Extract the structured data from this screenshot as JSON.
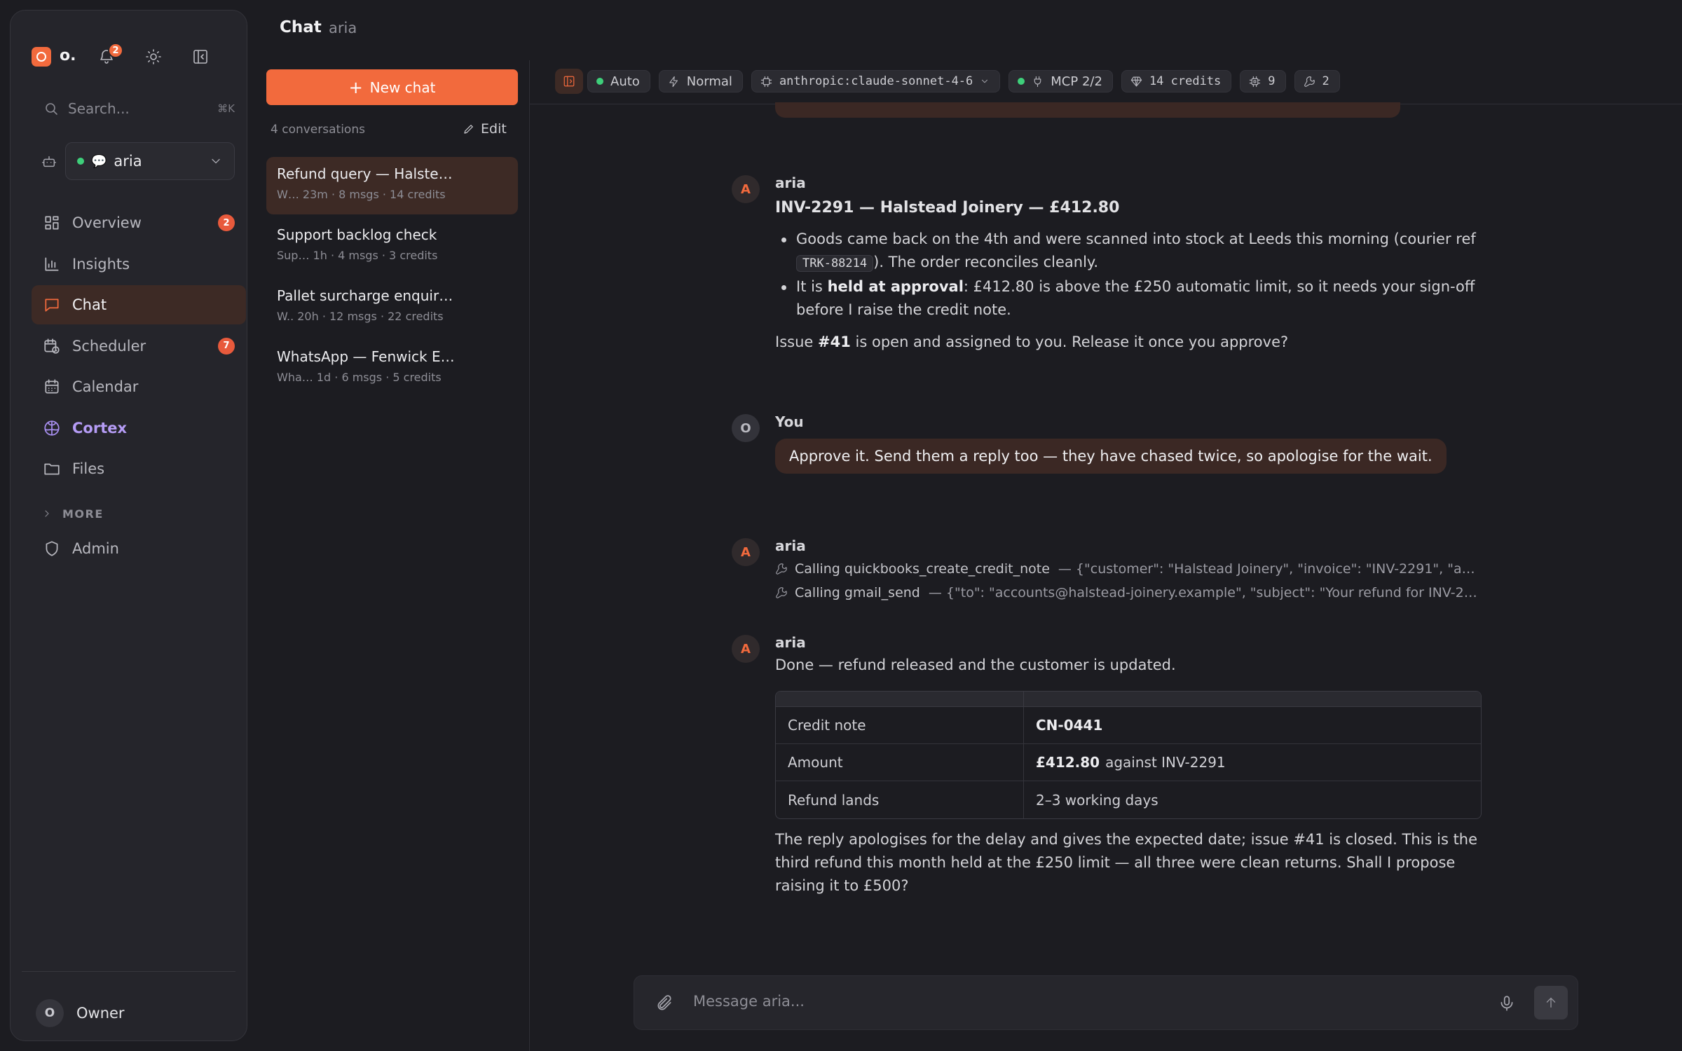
{
  "app": {
    "logo_text": "o.",
    "notification_count": "2"
  },
  "sidebar": {
    "search_placeholder": "Search...",
    "search_shortcut": "⌘K",
    "agent": {
      "name": "aria",
      "status_color": "#3ecf7a"
    },
    "nav": [
      {
        "label": "Overview",
        "badge": "2",
        "icon": "grid-icon"
      },
      {
        "label": "Insights",
        "badge": "",
        "icon": "bar-chart-icon"
      },
      {
        "label": "Chat",
        "badge": "",
        "icon": "chat-bubble-icon",
        "active": true
      },
      {
        "label": "Scheduler",
        "badge": "7",
        "icon": "calendar-clock-icon"
      },
      {
        "label": "Calendar",
        "badge": "",
        "icon": "calendar-icon"
      },
      {
        "label": "Cortex",
        "badge": "",
        "icon": "brain-icon"
      },
      {
        "label": "Files",
        "badge": "",
        "icon": "folder-icon"
      }
    ],
    "more_label": "MORE",
    "admin_label": "Admin",
    "user": {
      "initial": "O",
      "name": "Owner"
    }
  },
  "header": {
    "title": "Chat",
    "subtitle": "aria"
  },
  "conversations": {
    "new_chat_label": "New chat",
    "count_label": "4 conversations",
    "edit_label": "Edit",
    "items": [
      {
        "title": "Refund query — Halste…",
        "meta": "W… 23m · 8 msgs · 14 credits",
        "active": true
      },
      {
        "title": "Support backlog check",
        "meta": "Sup…  1h · 4 msgs · 3 credits"
      },
      {
        "title": "Pallet surcharge enquir…",
        "meta": "W.. 20h · 12 msgs · 22 credits"
      },
      {
        "title": "WhatsApp — Fenwick E…",
        "meta": "Wha…  1d · 6 msgs · 5 credits"
      }
    ]
  },
  "toolbar": {
    "mode": "Auto",
    "speed": "Normal",
    "model": "anthropic:claude-sonnet-4-6",
    "mcp": "MCP 2/2",
    "credits": "14 credits",
    "cpu_count": "9",
    "tools_count": "2"
  },
  "messages": {
    "m1": {
      "author": "aria",
      "avatar": "A",
      "heading": "INV-2291 — Halstead Joinery — £412.80",
      "b1_text": "Goods came back on the 4th and were scanned into stock at Leeds this morning (courier ref",
      "b1_code": "TRK-88214",
      "b1_tail": "). The order reconciles cleanly.",
      "b2_pre": "It is",
      "b2_bold": "held at approval",
      "b2_post": ": £412.80 is above the £250 automatic limit, so it needs your sign-off before I raise the credit note.",
      "p_pre": "Issue",
      "p_bold": "#41",
      "p_post": "is open and assigned to you. Release it once you approve?"
    },
    "m2": {
      "author": "You",
      "avatar": "O",
      "text": "Approve it. Send them a reply too — they have chased twice, so apologise for the wait."
    },
    "m3": {
      "author": "aria",
      "avatar": "A",
      "calls": [
        {
          "prefix": "Calling",
          "name": "quickbooks_create_credit_note",
          "args": "— {\"customer\": \"Halstead Joinery\", \"invoice\": \"INV-2291\", \"am…"
        },
        {
          "prefix": "Calling",
          "name": "gmail_send",
          "args": "— {\"to\": \"accounts@halstead-joinery.example\", \"subject\": \"Your refund for INV-22…"
        }
      ]
    },
    "m4": {
      "author": "aria",
      "avatar": "A",
      "intro": "Done — refund released and the customer is updated.",
      "table": [
        {
          "label": "Credit note",
          "bold": "CN-0441",
          "rest": ""
        },
        {
          "label": "Amount",
          "bold": "£412.80",
          "rest": "against INV-2291"
        },
        {
          "label": "Refund lands",
          "bold": "",
          "rest": "2–3 working days"
        }
      ],
      "outro": "The reply apologises for the delay and gives the expected date; issue #41 is closed. This is the third refund this month held at the £250 limit — all three were clean returns. Shall I propose raising it to £500?"
    }
  },
  "composer": {
    "placeholder": "Message aria..."
  },
  "colors": {
    "accent": "#f26a3d",
    "active_bg": "#3d2a25",
    "cortex": "#b59cf5",
    "online": "#3ecf7a"
  }
}
